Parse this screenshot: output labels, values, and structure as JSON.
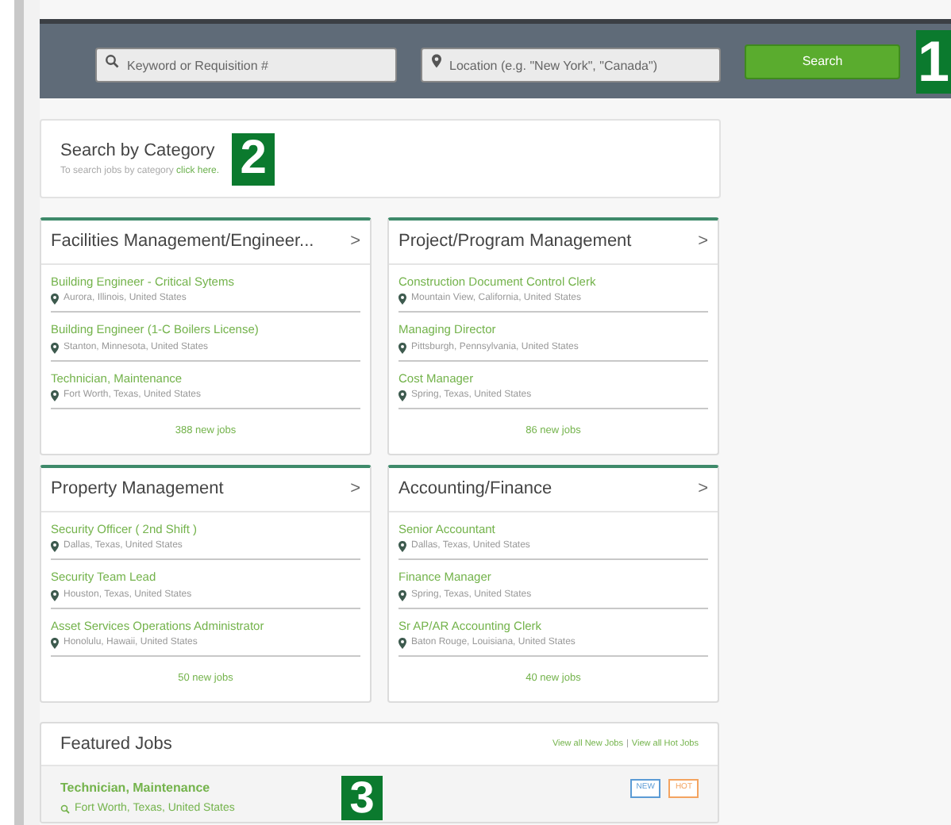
{
  "search_bar": {
    "keyword_placeholder": "Keyword or Requisition #",
    "location_placeholder": "Location (e.g. \"New York\", \"Canada\")",
    "button": "Search",
    "marker": "1"
  },
  "category_search": {
    "title": "Search by Category",
    "text": "To search jobs by category",
    "link": "click here.",
    "marker": "2"
  },
  "categories": [
    {
      "title": "Facilities Management/Engineer...",
      "arrow": ">",
      "jobs": [
        {
          "title": "Building Engineer - Critical Sytems",
          "location": "Aurora, Illinois, United States"
        },
        {
          "title": "Building Engineer (1-C Boilers License)",
          "location": "Stanton, Minnesota, United States"
        },
        {
          "title": "Technician, Maintenance",
          "location": "Fort Worth, Texas, United States"
        }
      ],
      "count": "388 new jobs"
    },
    {
      "title": "Project/Program Management",
      "arrow": ">",
      "jobs": [
        {
          "title": "Construction Document Control Clerk",
          "location": "Mountain View, California, United States"
        },
        {
          "title": "Managing Director",
          "location": "Pittsburgh, Pennsylvania, United States"
        },
        {
          "title": "Cost Manager",
          "location": "Spring, Texas, United States"
        }
      ],
      "count": "86 new jobs"
    },
    {
      "title": "Property Management",
      "arrow": ">",
      "jobs": [
        {
          "title": "Security Officer ( 2nd Shift )",
          "location": "Dallas, Texas, United States"
        },
        {
          "title": "Security Team Lead",
          "location": "Houston, Texas, United States"
        },
        {
          "title": "Asset Services Operations Administrator",
          "location": "Honolulu, Hawaii, United States"
        }
      ],
      "count": "50 new jobs"
    },
    {
      "title": "Accounting/Finance",
      "arrow": ">",
      "jobs": [
        {
          "title": "Senior Accountant",
          "location": "Dallas, Texas, United States"
        },
        {
          "title": "Finance Manager",
          "location": "Spring, Texas, United States"
        },
        {
          "title": "Sr AP/AR Accounting Clerk",
          "location": "Baton Rouge, Louisiana, United States"
        }
      ],
      "count": "40 new jobs"
    }
  ],
  "featured": {
    "title": "Featured Jobs",
    "links": [
      "View all New Jobs",
      "View all Hot Jobs"
    ],
    "separator": "|",
    "marker": "3",
    "jobs": [
      {
        "title": "Technician, Maintenance",
        "location": "Fort Worth, Texas, United States",
        "tags": [
          {
            "label": "NEW",
            "color": "#5b9bd5"
          },
          {
            "label": "HOT",
            "color": "#f4a460"
          }
        ]
      }
    ]
  }
}
